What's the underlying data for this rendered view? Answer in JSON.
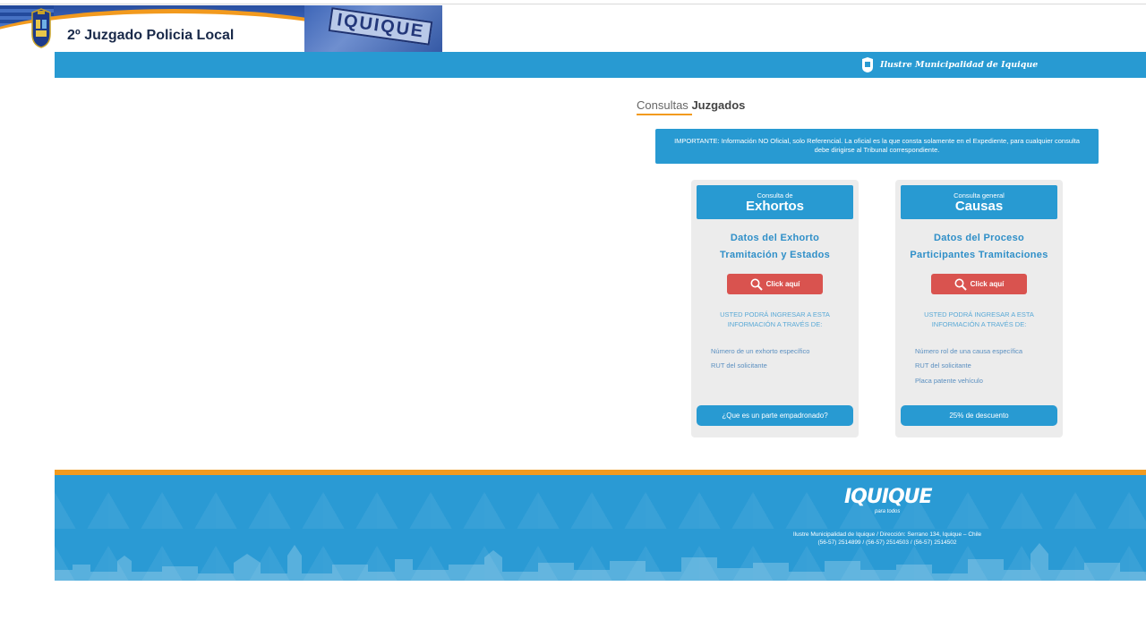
{
  "header": {
    "title": "2º Juzgado Policia Local",
    "banner_sign": "IQUIQUE"
  },
  "strip": {
    "text": "Ilustre Municipalidad de Iquique"
  },
  "section": {
    "title_light": "Consultas",
    "title_bold": "Juzgados"
  },
  "notice": {
    "text": "IMPORTANTE: Información NO Oficial, solo Referencial. La oficial es la que consta solamente en el Expediente, para cualquier consulta debe dirigirse al Tribunal correspondiente."
  },
  "cards": [
    {
      "subtitle": "Consulta de",
      "title": "Exhortos",
      "line1": "Datos del Exhorto",
      "line2": "Tramitación y Estados",
      "button": "Click aquí",
      "info": "USTED PODRÁ INGRESAR A ESTA INFORMACIÓN A TRAVÉS DE:",
      "options": [
        "Número de un exhorto específico",
        "RUT del solicitante"
      ],
      "bottom_button": "¿Que es un parte empadronado?"
    },
    {
      "subtitle": "Consulta general",
      "title": "Causas",
      "line1": "Datos del Proceso",
      "line2": "Participantes Tramitaciones",
      "button": "Click aquí",
      "info": "USTED PODRÁ INGRESAR A ESTA INFORMACIÓN A TRAVÉS DE:",
      "options": [
        "Número rol de una causa específica",
        "RUT del solicitante",
        "Placa patente vehículo"
      ],
      "bottom_button": "25% de descuento"
    }
  ],
  "footer": {
    "logo": "IQUIQUE",
    "slogan": "para todos",
    "address": "Ilustre Municipalidad de Iquique / Dirección: Serrano 134, Iquique – Chile",
    "phones": "(56-57) 2514899 / (56-57) 2514503 / (56-57) 2514502"
  },
  "colors": {
    "primary_blue": "#289ad2",
    "accent_orange": "#f29a1e",
    "button_red": "#d9534f"
  }
}
